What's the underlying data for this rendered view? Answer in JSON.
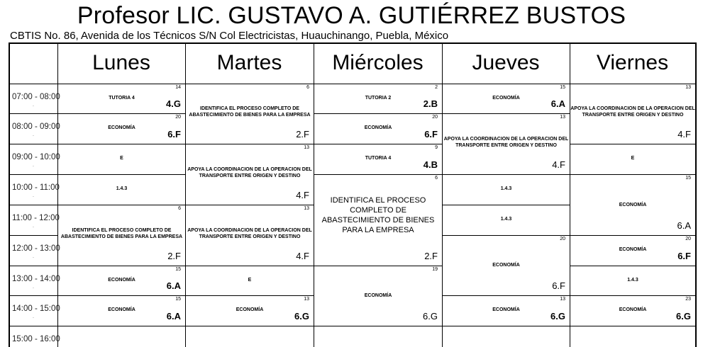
{
  "header": {
    "title": "Profesor LIC. GUSTAVO A. GUTIÉRREZ BUSTOS",
    "subtitle": "CBTIS No. 86, Avenida de los Técnicos S/N Col Electricistas, Huauchinango, Puebla, México"
  },
  "days": [
    "Lunes",
    "Martes",
    "Miércoles",
    "Jueves",
    "Viernes"
  ],
  "times": [
    "07:00 - 08:00",
    "08:00 - 09:00",
    "09:00 - 10:00",
    "10:00 - 11:00",
    "11:00 - 12:00",
    "12:00 - 13:00",
    "13:00 - 14:00",
    "14:00 - 15:00",
    "15:00 - 16:00"
  ],
  "tick": ".",
  "cells": [
    {
      "day": 0,
      "start": 0,
      "span": 1,
      "num": "14",
      "subject": "TUTORIA 4",
      "group": "4.G",
      "group_bold": true
    },
    {
      "day": 0,
      "start": 1,
      "span": 1,
      "num": "20",
      "subject": "ECONOMÍA",
      "group": "6.F",
      "group_bold": true
    },
    {
      "day": 0,
      "start": 2,
      "span": 1,
      "num": "",
      "subject": "E",
      "group": ""
    },
    {
      "day": 0,
      "start": 3,
      "span": 1,
      "num": "",
      "subject": "1.4.3",
      "group": ""
    },
    {
      "day": 0,
      "start": 4,
      "span": 2,
      "num": "6",
      "subject": "IDENTIFICA EL PROCESO COMPLETO DE ABASTECIMIENTO DE BIENES PARA LA EMPRESA",
      "group": "2.F"
    },
    {
      "day": 0,
      "start": 6,
      "span": 1,
      "num": "15",
      "subject": "ECONOMÍA",
      "group": "6.A",
      "group_bold": true
    },
    {
      "day": 0,
      "start": 7,
      "span": 1,
      "num": "15",
      "subject": "ECONOMÍA",
      "group": "6.A",
      "group_bold": true
    },
    {
      "day": 1,
      "start": 0,
      "span": 2,
      "num": "6",
      "subject": "IDENTIFICA EL PROCESO COMPLETO DE ABASTECIMIENTO DE BIENES PARA LA EMPRESA",
      "group": "2.F"
    },
    {
      "day": 1,
      "start": 2,
      "span": 2,
      "num": "13",
      "subject": "APOYA LA COORDINACION DE LA OPERACION DEL TRANSPORTE ENTRE ORIGEN Y DESTINO",
      "group": "4.F"
    },
    {
      "day": 1,
      "start": 4,
      "span": 2,
      "num": "13",
      "subject": "APOYA LA COORDINACION DE LA OPERACION DEL TRANSPORTE ENTRE ORIGEN Y DESTINO",
      "group": "4.F"
    },
    {
      "day": 1,
      "start": 6,
      "span": 1,
      "num": "",
      "subject": "E",
      "group": ""
    },
    {
      "day": 1,
      "start": 7,
      "span": 1,
      "num": "13",
      "subject": "ECONOMÍA",
      "group": "6.G",
      "group_bold": true
    },
    {
      "day": 2,
      "start": 0,
      "span": 1,
      "num": "2",
      "subject": "TUTORIA 2",
      "group": "2.B",
      "group_bold": true
    },
    {
      "day": 2,
      "start": 1,
      "span": 1,
      "num": "20",
      "subject": "ECONOMÍA",
      "group": "6.F",
      "group_bold": true
    },
    {
      "day": 2,
      "start": 2,
      "span": 1,
      "num": "9",
      "subject": "TUTORIA 4",
      "group": "4.B",
      "group_bold": true
    },
    {
      "day": 2,
      "start": 3,
      "span": 3,
      "num": "6",
      "subject": "IDENTIFICA EL PROCESO COMPLETO DE ABASTECIMIENTO DE BIENES PARA LA EMPRESA",
      "group": "2.F",
      "big": true
    },
    {
      "day": 2,
      "start": 6,
      "span": 2,
      "num": "19",
      "subject": "ECONOMÍA",
      "group": "6.G"
    },
    {
      "day": 3,
      "start": 0,
      "span": 1,
      "num": "15",
      "subject": "ECONOMÍA",
      "group": "6.A",
      "group_bold": true
    },
    {
      "day": 3,
      "start": 1,
      "span": 2,
      "num": "13",
      "subject": "APOYA LA COORDINACION DE LA OPERACION DEL TRANSPORTE ENTRE ORIGEN Y DESTINO",
      "group": "4.F"
    },
    {
      "day": 3,
      "start": 3,
      "span": 1,
      "num": "",
      "subject": "1.4.3",
      "group": ""
    },
    {
      "day": 3,
      "start": 4,
      "span": 1,
      "num": "",
      "subject": "1.4.3",
      "group": ""
    },
    {
      "day": 3,
      "start": 5,
      "span": 2,
      "num": "20",
      "subject": "ECONOMÍA",
      "group": "6.F"
    },
    {
      "day": 3,
      "start": 7,
      "span": 1,
      "num": "13",
      "subject": "ECONOMÍA",
      "group": "6.G",
      "group_bold": true
    },
    {
      "day": 4,
      "start": 0,
      "span": 2,
      "num": "13",
      "subject": "APOYA LA COORDINACION DE LA OPERACION DEL TRANSPORTE ENTRE ORIGEN Y DESTINO",
      "group": "4.F"
    },
    {
      "day": 4,
      "start": 2,
      "span": 1,
      "num": "",
      "subject": "E",
      "group": ""
    },
    {
      "day": 4,
      "start": 3,
      "span": 2,
      "num": "15",
      "subject": "ECONOMÍA",
      "group": "6.A"
    },
    {
      "day": 4,
      "start": 5,
      "span": 1,
      "num": "20",
      "subject": "ECONOMÍA",
      "group": "6.F",
      "group_bold": true
    },
    {
      "day": 4,
      "start": 6,
      "span": 1,
      "num": "",
      "subject": "1.4.3",
      "group": ""
    },
    {
      "day": 4,
      "start": 7,
      "span": 1,
      "num": "23",
      "subject": "ECONOMÍA",
      "group": "6.G",
      "group_bold": true
    }
  ]
}
